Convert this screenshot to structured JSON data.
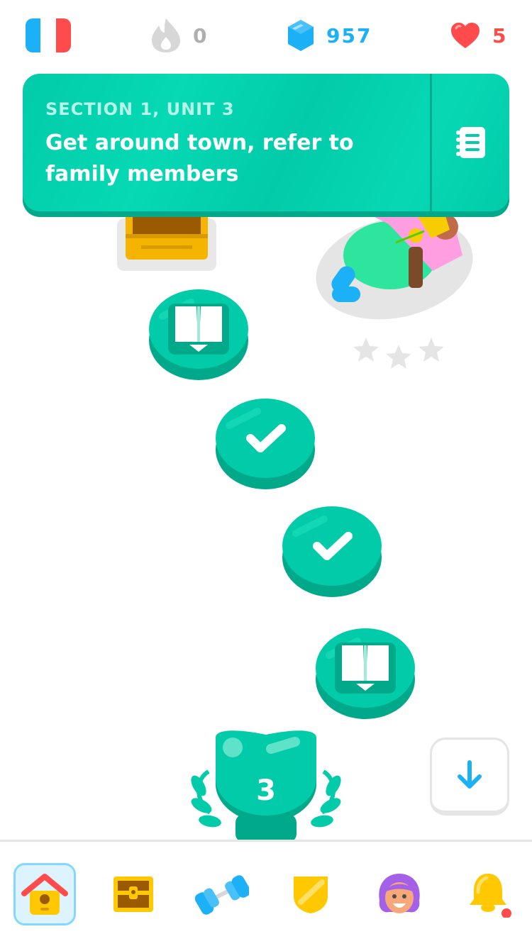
{
  "status": {
    "course_flag": "french-flag",
    "streak": "0",
    "gems": "957",
    "hearts": "5"
  },
  "colors": {
    "accent": "#02cba9",
    "accent_dark": "#00a98a",
    "gems_blue": "#1cb0f6",
    "hearts_red": "#ff4b4b",
    "inactive_gray": "#afafaf"
  },
  "banner": {
    "section_label": "SECTION 1, UNIT 3",
    "unit_title": "Get around town, refer to family members",
    "guide_icon": "guidebook-icon"
  },
  "path": {
    "nodes": [
      {
        "type": "lesson",
        "icon": "book-icon",
        "state": "completed"
      },
      {
        "type": "lesson",
        "icon": "check-icon",
        "state": "completed"
      },
      {
        "type": "lesson",
        "icon": "check-icon",
        "state": "completed"
      },
      {
        "type": "lesson",
        "icon": "book-icon",
        "state": "completed"
      }
    ],
    "character_stars": 3,
    "trophy_unit": "3"
  },
  "nav": {
    "items": [
      {
        "name": "learn",
        "icon": "home-icon",
        "active": true
      },
      {
        "name": "chest",
        "icon": "treasure-chest-icon",
        "active": false
      },
      {
        "name": "practice",
        "icon": "dumbbell-icon",
        "active": false
      },
      {
        "name": "leagues",
        "icon": "shield-icon",
        "active": false
      },
      {
        "name": "profile",
        "icon": "avatar-icon",
        "active": false
      },
      {
        "name": "notifications",
        "icon": "bell-icon",
        "active": false
      }
    ]
  }
}
